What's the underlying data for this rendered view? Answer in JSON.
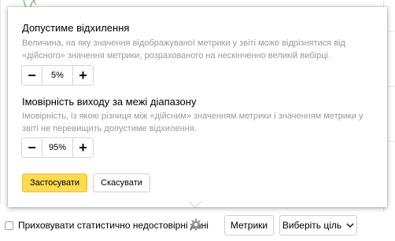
{
  "popup": {
    "error": {
      "title": "Допустиме відхилення",
      "description": "Величина, на яку значення відображуваної метрики у звіті може відрізнятися від «дійсного» значення метрики, розрахованого на нескінченно великій вибірці.",
      "value": "5%"
    },
    "probability": {
      "title": "Імовірність виходу за межі діапазону",
      "description": "Імовірність, із якою різниця між «дійсним» значенням метрики і значенням метрики у звіті не перевищить допустиме відхилення.",
      "value": "95%"
    },
    "apply_label": "Застосувати",
    "cancel_label": "Скасувати",
    "minus_symbol": "−",
    "plus_symbol": "+"
  },
  "toolbar": {
    "hide_unreliable_label": "Приховувати статистично недостовірні дані",
    "metrics_label": "Метрики",
    "goal_label": "Виберіть ціль"
  },
  "colors": {
    "apply_bg": "#ffdb4d",
    "muted_text": "#9a9a9a",
    "chart_green": "#7fc97f",
    "chart_red": "#e07070"
  },
  "icons": {
    "gear": "gear-icon",
    "dropdown": "chevron-down-icon"
  }
}
